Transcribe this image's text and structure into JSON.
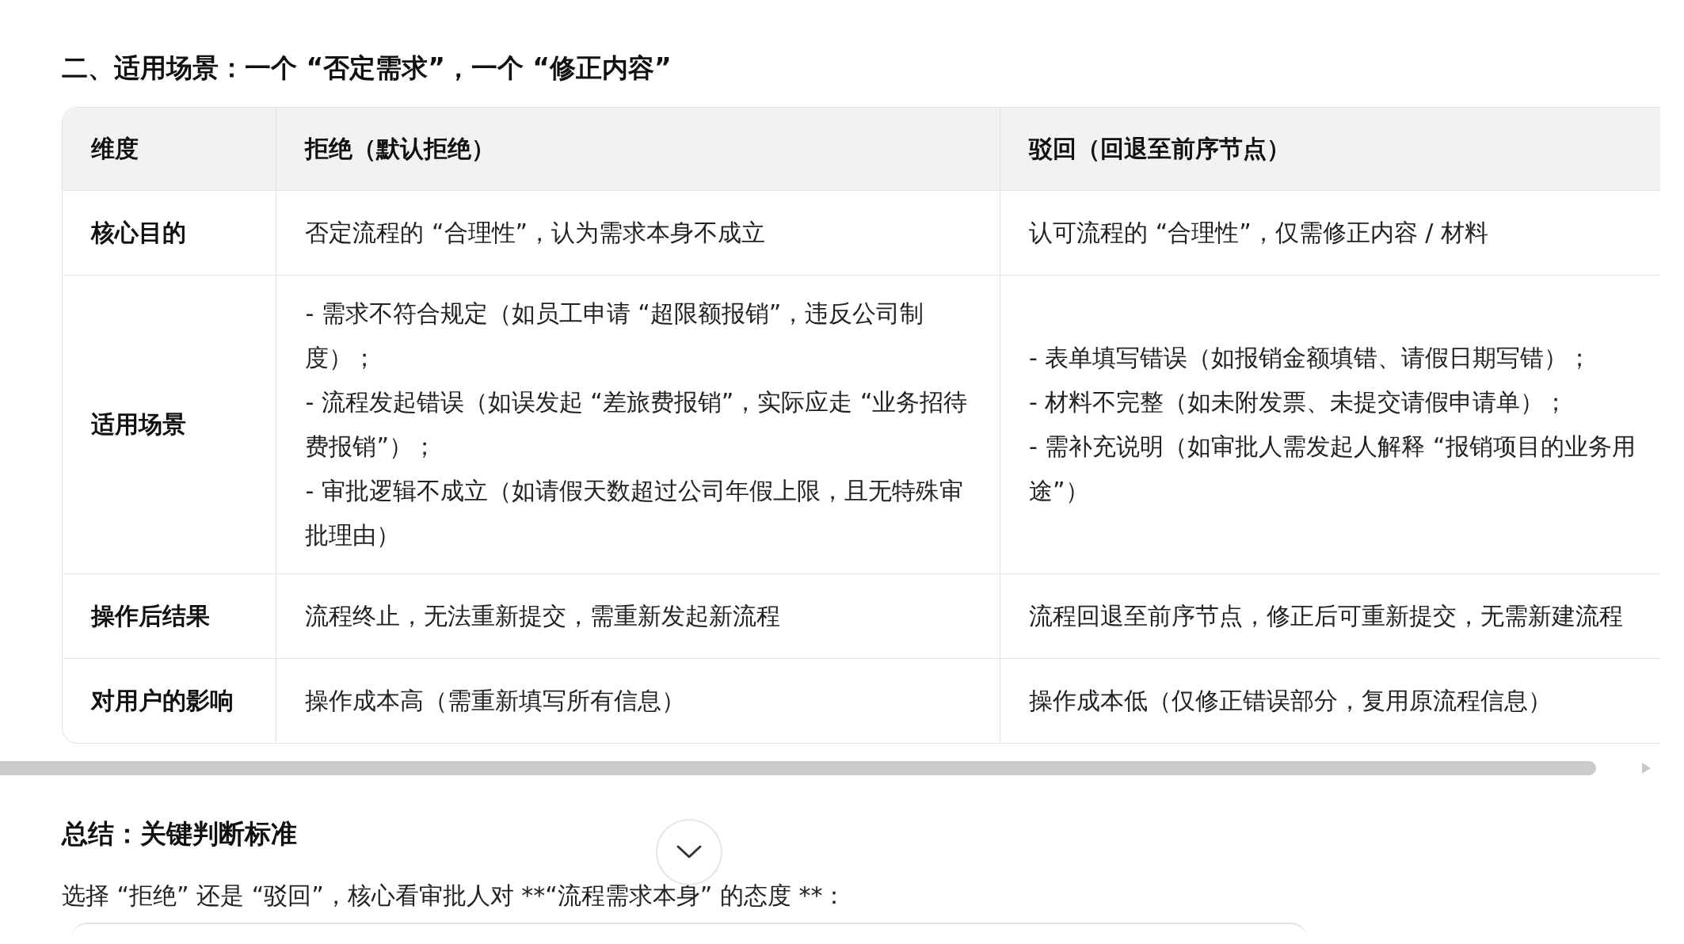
{
  "section_heading": "二、适用场景：一个 “否定需求”，一个 “修正内容”",
  "table": {
    "columns": [
      "维度",
      "拒绝（默认拒绝）",
      "驳回（回退至前序节点）"
    ],
    "rows": [
      {
        "cells": [
          [
            "核心目的"
          ],
          [
            "否定流程的 “合理性”，认为需求本身不成立"
          ],
          [
            "认可流程的 “合理性”，仅需修正内容 / 材料"
          ]
        ]
      },
      {
        "cells": [
          [
            "适用场景"
          ],
          [
            "- 需求不符合规定（如员工申请 “超限额报销”，违反公司制度）；",
            "- 流程发起错误（如误发起 “差旅费报销”，实际应走 “业务招待费报销”）；",
            "- 审批逻辑不成立（如请假天数超过公司年假上限，且无特殊审批理由）"
          ],
          [
            "- 表单填写错误（如报销金额填错、请假日期写错）；",
            "- 材料不完整（如未附发票、未提交请假申请单）；",
            "- 需补充说明（如审批人需发起人解释 “报销项目的业务用途”）"
          ]
        ]
      },
      {
        "cells": [
          [
            "操作后结果"
          ],
          [
            "流程终止，无法重新提交，需重新发起新流程"
          ],
          [
            "流程回退至前序节点，修正后可重新提交，无需新建流程"
          ]
        ]
      },
      {
        "cells": [
          [
            "对用户的影响"
          ],
          [
            "操作成本高（需重新填写所有信息）"
          ],
          [
            "操作成本低（仅修正错误部分，复用原流程信息）"
          ]
        ]
      }
    ]
  },
  "summary_heading": "总结：关键判断标准",
  "summary_text": "选择 “拒绝” 还是 “驳回”，核心看审批人对 **“流程需求本身” 的态度 **："
}
